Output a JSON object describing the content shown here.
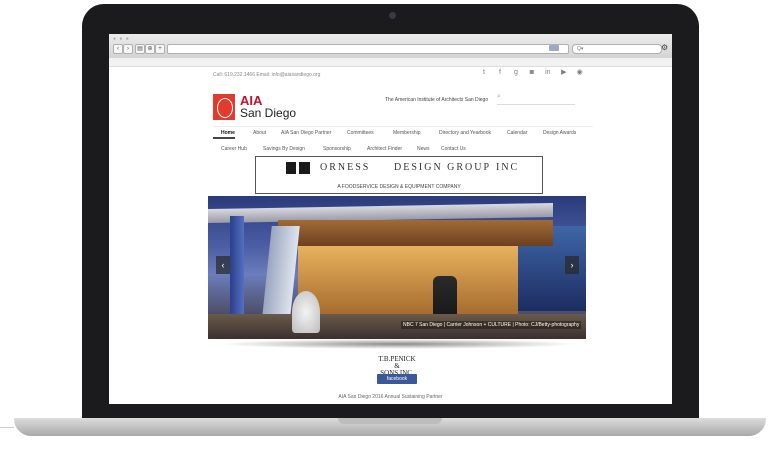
{
  "browser": {
    "nav_back": "‹",
    "nav_forward": "›",
    "nav_reader": "▤",
    "nav_share": "⊕",
    "nav_add": "+",
    "search_placeholder": "Q▾",
    "gear": "⚙"
  },
  "header": {
    "contact_line": "Call: 619.232.1466   Email: info@aiasandiego.org",
    "social_icons": [
      "twitter-icon",
      "facebook-icon",
      "google-plus-icon",
      "instagram-icon",
      "linkedin-icon",
      "youtube-icon",
      "rss-icon"
    ],
    "social_glyphs": [
      "t",
      "f",
      "g",
      "◙",
      "in",
      "▶",
      "◉"
    ],
    "logo_aia": "AIA",
    "logo_city": "San Diego",
    "tagline": "The American Institute of Architects San Diego",
    "search_icon": "⌕"
  },
  "nav": {
    "row1": [
      "Home",
      "About",
      "AIA San Diego Partner",
      "Committees",
      "Membership",
      "Directory and Yearbook",
      "Calendar",
      "Design Awards"
    ],
    "row2": [
      "Career Hub",
      "Savings By Design",
      "Sponsorship",
      "Architect Finder",
      "News",
      "Contact Us"
    ]
  },
  "ad": {
    "word1": "ORNESS",
    "word2": "DESIGN GROUP",
    "word3": "INC",
    "subtitle": "A FOODSERVICE DESIGN & EQUIPMENT COMPANY"
  },
  "slider": {
    "prev": "‹",
    "next": "›",
    "caption": "NBC 7 San Diego | Carrier Johnson + CULTURE | Photo: CJ/Betty-photography"
  },
  "sponsor": {
    "name": "T.B.PENICK & SONS,INC.",
    "facebook_label": "facebook"
  },
  "footer": {
    "text": "AIA San Diego 2016 Annual Sustaining Partner"
  }
}
